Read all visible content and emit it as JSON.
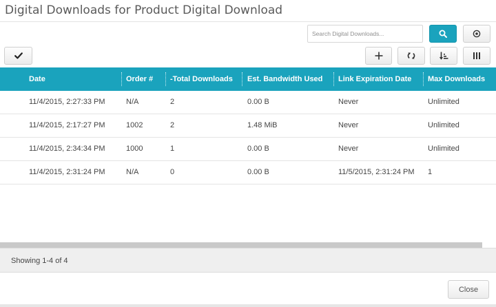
{
  "dialog": {
    "title": "Digital Downloads for Product Digital Download"
  },
  "toolbar": {
    "search_placeholder": "Search Digital Downloads...",
    "search_icon": "search-icon",
    "settings_icon": "target-icon",
    "check_icon": "checkmark-icon",
    "add_icon": "plus-icon",
    "refresh_icon": "refresh-icon",
    "sort_icon": "sort-icon",
    "columns_icon": "columns-icon"
  },
  "table": {
    "columns": [
      "Date",
      "Order #",
      "-Total Downloads",
      "Est. Bandwidth Used",
      "Link Expiration Date",
      "Max Downloads"
    ],
    "rows": [
      [
        "11/4/2015, 2:27:33 PM",
        "N/A",
        "2",
        "0.00 B",
        "Never",
        "Unlimited"
      ],
      [
        "11/4/2015, 2:17:27 PM",
        "1002",
        "2",
        "1.48 MiB",
        "Never",
        "Unlimited"
      ],
      [
        "11/4/2015, 2:34:34 PM",
        "1000",
        "1",
        "0.00 B",
        "Never",
        "Unlimited"
      ],
      [
        "11/4/2015, 2:31:24 PM",
        "N/A",
        "0",
        "0.00 B",
        "11/5/2015, 2:31:24 PM",
        "1"
      ]
    ]
  },
  "footer": {
    "status": "Showing 1-4 of 4",
    "close_label": "Close"
  },
  "colors": {
    "accent": "#1aa3bd",
    "header_text": "#ffffff"
  }
}
